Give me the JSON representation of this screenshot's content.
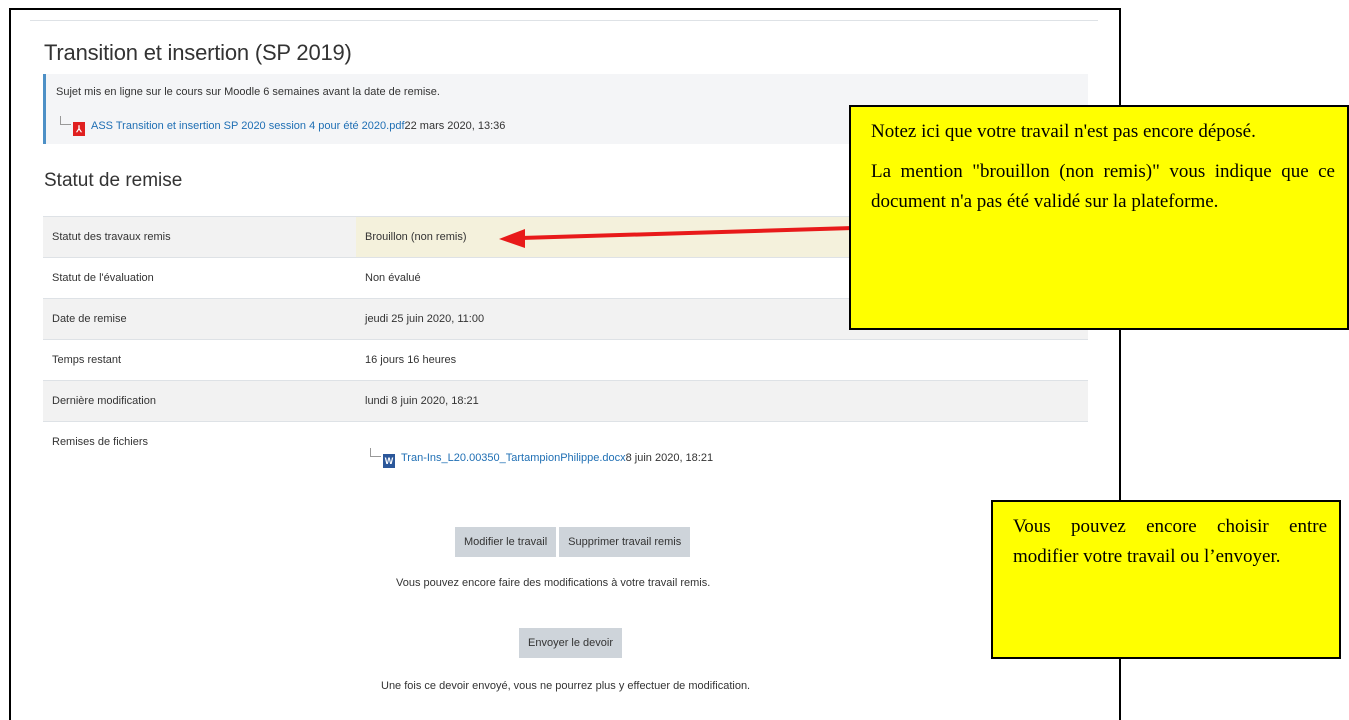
{
  "page": {
    "title": "Transition et insertion (SP 2019)",
    "intro_text": "Sujet mis en ligne sur le cours sur Moodle 6 semaines avant la date de remise.",
    "intro_file_name": "ASS Transition et insertion SP 2020 session 4 pour été 2020.pdf",
    "intro_file_date": "22 mars 2020, 13:36",
    "section_title": "Statut de remise"
  },
  "status_table": {
    "submission_status_label": "Statut des travaux remis",
    "submission_status_value": "Brouillon (non remis)",
    "grading_status_label": "Statut de l'évaluation",
    "grading_status_value": "Non évalué",
    "due_date_label": "Date de remise",
    "due_date_value": "jeudi 25 juin 2020, 11:00",
    "time_remaining_label": "Temps restant",
    "time_remaining_value": "16 jours 16 heures",
    "last_modified_label": "Dernière modification",
    "last_modified_value": "lundi 8 juin 2020, 18:21",
    "file_submissions_label": "Remises de fichiers",
    "file_name": "Tran-Ins_L20.00350_TartampionPhilippe.docx",
    "file_date": "8 juin 2020, 18:21"
  },
  "actions": {
    "edit_label": "Modifier le travail",
    "remove_label": "Supprimer travail remis",
    "edit_note": "Vous pouvez encore faire des modifications à votre travail remis.",
    "submit_label": "Envoyer le devoir",
    "submit_note": "Une fois ce devoir envoyé, vous ne pourrez plus y effectuer de modification."
  },
  "callouts": {
    "status_p1": "Notez ici que votre travail n'est pas encore déposé.",
    "status_p2": "La mention \"brouillon (non remis)\" vous indique que ce document n'a pas été validé sur la plateforme.",
    "choice": "Vous pouvez encore choisir entre modifier votre travail ou l’envoyer."
  },
  "icons": {
    "pdf": "pdf-file-icon",
    "word": "word-file-icon",
    "arrow": "red-arrow"
  },
  "colors": {
    "callout_bg": "#ffff00",
    "arrow": "#e81a1a",
    "link": "#1f6fb4",
    "button_bg": "#ced4da"
  }
}
